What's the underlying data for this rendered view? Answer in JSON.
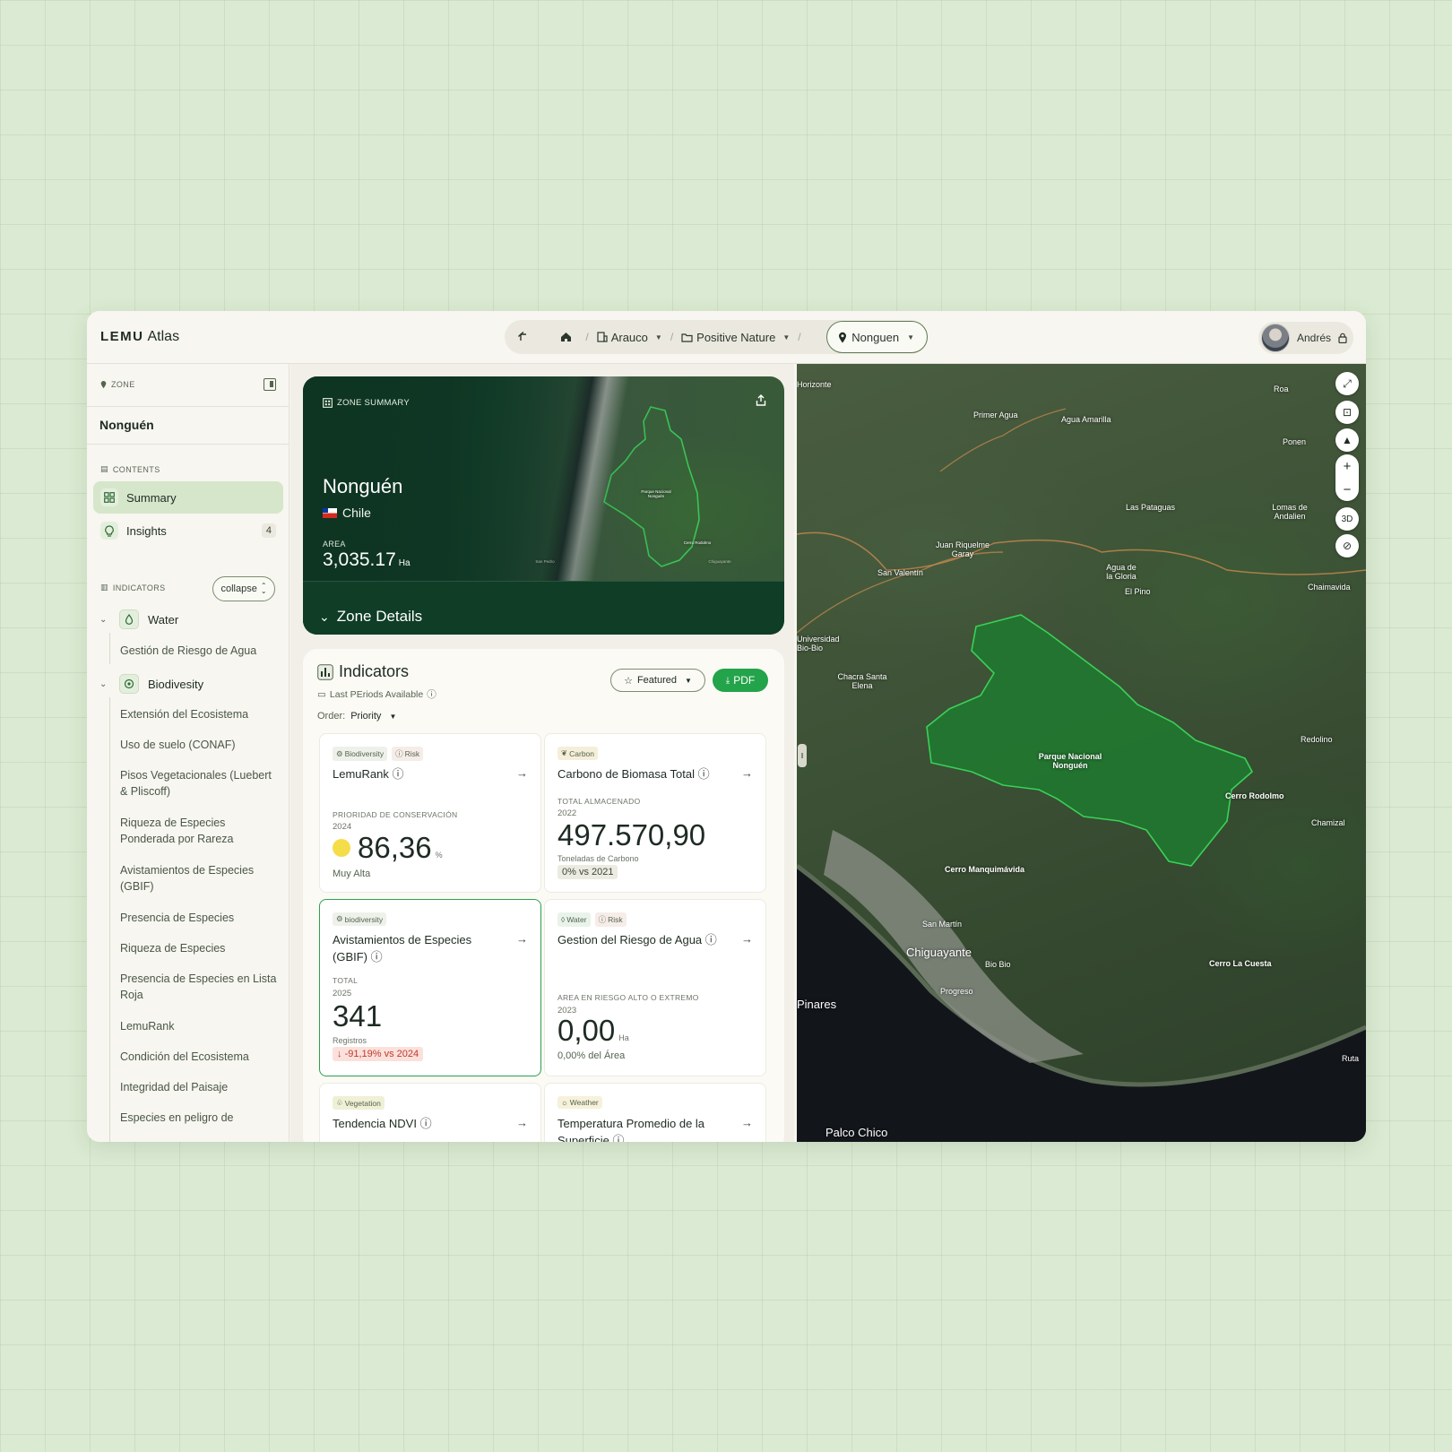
{
  "app": {
    "logo_mark": "LEMU",
    "logo_text": "Atlas"
  },
  "breadcrumb": {
    "items": [
      {
        "label": "Arauco",
        "icon": "building-icon"
      },
      {
        "label": "Positive Nature",
        "icon": "folder-icon"
      }
    ],
    "active": "Nonguen"
  },
  "user": {
    "name": "Andrés"
  },
  "sidebar": {
    "zone_label": "ZONE",
    "zone_name": "Nonguén",
    "contents_label": "CONTENTS",
    "nav": [
      {
        "label": "Summary"
      },
      {
        "label": "Insights",
        "badge": "4"
      }
    ],
    "indicators_label": "INDICATORS",
    "collapse_label": "collapse",
    "groups": [
      {
        "label": "Water",
        "items": [
          "Gestión de Riesgo de Agua"
        ]
      },
      {
        "label": "Biodivesity",
        "items": [
          "Extensión del Ecosistema",
          "Uso de suelo (CONAF)",
          "Pisos Vegetacionales (Luebert & Pliscoff)",
          "Riqueza de Especies Ponderada por Rareza",
          "Avistamientos de Especies (GBIF)",
          "Presencia de Especies",
          "Riqueza de Especies",
          "Presencia de Especies en Lista Roja",
          "LemuRank",
          "Condición del Ecosistema",
          "Integridad del Paisaje",
          "Especies en peligro de"
        ]
      }
    ]
  },
  "hero": {
    "label": "ZONE SUMMARY",
    "title": "Nonguén",
    "country": "Chile",
    "area_label": "AREA",
    "area_value": "3,035.17",
    "area_unit": "Ha",
    "details_label": "Zone Details",
    "map_labels": [
      "Parque Nacional Nonguén",
      "Cerro Rodolmo",
      "San Pedro",
      "Chiguayante"
    ]
  },
  "indicators": {
    "title": "Indicators",
    "subtitle": "Last PEriods Available",
    "order_label": "Order:",
    "order_value": "Priority",
    "featured_label": "Featured",
    "pdf_label": "PDF",
    "cards": [
      {
        "tags": [
          "Biodiversity",
          "Risk"
        ],
        "title": "LemuRank",
        "metric_label": "PRIORIDAD DE CONSERVACIÓN",
        "year": "2024",
        "value": "86,36",
        "unit": "%",
        "footer": "Muy Alta"
      },
      {
        "tags": [
          "Carbon"
        ],
        "title": "Carbono de Biomasa Total",
        "metric_label": "TOTAL ALMACENADO",
        "year": "2022",
        "value": "497.570,90",
        "unit": "Toneladas de Carbono",
        "footer": "0% vs 2021"
      },
      {
        "tags": [
          "biodiversity"
        ],
        "title": "Avistamientos de Especies (GBIF)",
        "metric_label": "TOTAL",
        "year": "2025",
        "value": "341",
        "unit": "Registros",
        "footer": "-91,19% vs 2024"
      },
      {
        "tags": [
          "Water",
          "Risk"
        ],
        "title": "Gestion del Riesgo de Agua",
        "metric_label": "AREA EN RIESGO ALTO O EXTREMO",
        "year": "2023",
        "value": "0,00",
        "unit": "Ha",
        "footer": "0,00% del Área"
      },
      {
        "tags": [
          "Vegetation"
        ],
        "title": "Tendencia NDVI"
      },
      {
        "tags": [
          "Weather"
        ],
        "title": "Temperatura Promedio de la Superficie"
      }
    ]
  },
  "map": {
    "labels": [
      "Primer Agua",
      "Agua Amarilla",
      "Roa",
      "Ponen",
      "Las Pataguas",
      "Lomas de Andalien",
      "Juan Riquelme Garay",
      "San Valentín",
      "Agua de la Gloria",
      "El Pino",
      "Chaimavida",
      "Universidad Bio-Bio",
      "Chacra Santa Elena",
      "Parque Nacional Nonguén",
      "Redolino",
      "Cerro Rodolmo",
      "Chamizal",
      "Cerro Manquimávida",
      "San Martín",
      "Chiguayante",
      "Progreso",
      "Bio Bio",
      "Cerro La Cuesta",
      "Pinares",
      "Palco Chico",
      "Horizonte",
      "Ruta"
    ],
    "control_3d": "3D"
  }
}
